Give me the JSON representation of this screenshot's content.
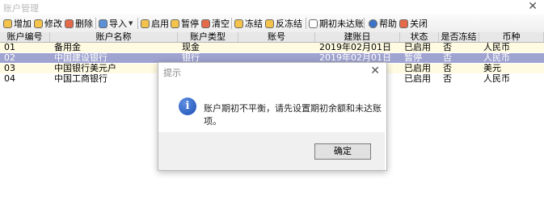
{
  "window": {
    "title": "账户管理",
    "close_glyph": "✕"
  },
  "toolbar": [
    {
      "label": "增加",
      "icon": "add-icon"
    },
    {
      "label": "修改",
      "icon": "edit-icon"
    },
    {
      "label": "删除",
      "icon": "delete-icon"
    },
    {
      "label": "导入",
      "icon": "import-icon",
      "dropdown": true
    },
    {
      "label": "启用",
      "icon": "enable-icon"
    },
    {
      "label": "暂停",
      "icon": "pause-icon"
    },
    {
      "label": "清空",
      "icon": "clear-icon"
    },
    {
      "label": "冻结",
      "icon": "freeze-icon"
    },
    {
      "label": "反冻结",
      "icon": "unfreeze-icon"
    },
    {
      "label": "期初未达账",
      "icon": "document-icon"
    },
    {
      "label": "帮助",
      "icon": "help-icon"
    },
    {
      "label": "关闭",
      "icon": "close-window-icon"
    }
  ],
  "table": {
    "headers": [
      "账户编号",
      "账户名称",
      "账户类型",
      "账号",
      "建账日",
      "状态",
      "是否冻结",
      "币种"
    ],
    "rows": [
      [
        "01",
        "备用金",
        "现金",
        "",
        "2019年02月01日",
        "已启用",
        "否",
        "人民币"
      ],
      [
        "02",
        "中国建设银行",
        "银行",
        "",
        "2019年02月01日",
        "暂停",
        "否",
        "人民币"
      ],
      [
        "03",
        "中国银行美元户",
        "",
        "",
        "",
        "已启用",
        "否",
        "美元"
      ],
      [
        "04",
        "中国工商银行",
        "",
        "",
        "",
        "已启用",
        "否",
        "人民币"
      ]
    ]
  },
  "dialog": {
    "title": "提示",
    "close_glyph": "✕",
    "icon_glyph": "i",
    "message": "账户期初不平衡，请先设置期初余额和未达账项。",
    "ok_label": "确定"
  },
  "colors": {
    "selected_row": "#9fa3cf",
    "row_highlight": "#fffbe2",
    "info_icon": "#1c4eb4"
  }
}
